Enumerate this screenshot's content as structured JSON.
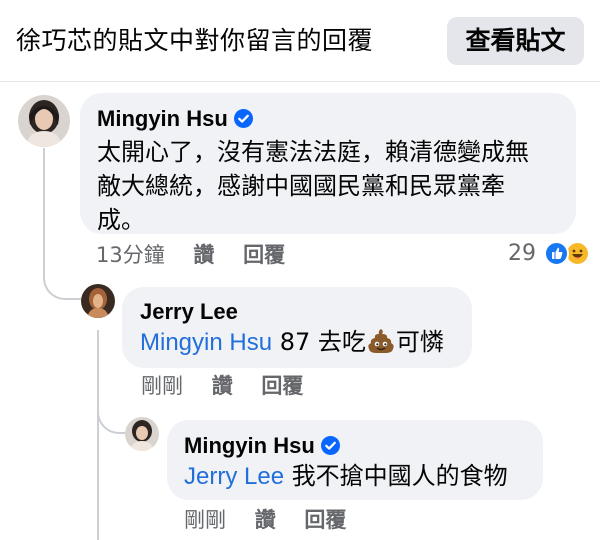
{
  "header": {
    "title": "徐巧芯的貼文中對你留言的回覆",
    "view_post_label": "查看貼文"
  },
  "comments": [
    {
      "author": "Mingyin Hsu",
      "verified": true,
      "text": "太開心了，沒有憲法法庭，賴清德變成無敵大總統，感謝中國國民黨和民眾黨牽成。",
      "text_lines": [
        "太開心了，沒有憲法法庭，賴清德變成無",
        "敵大總統，感謝中國國民黨和民眾黨牽",
        "成。"
      ],
      "time": "13分鐘",
      "like_label": "讚",
      "reply_label": "回覆",
      "reaction_count": "29",
      "reaction_icons": [
        "like-icon",
        "haha-icon"
      ]
    },
    {
      "author": "Jerry Lee",
      "verified": false,
      "mention": "Mingyin Hsu",
      "text_before_icon": "87 去吃",
      "icon": "poop-emoji-icon",
      "text_after_icon": "可憐",
      "time": "剛剛",
      "like_label": "讚",
      "reply_label": "回覆"
    },
    {
      "author": "Mingyin Hsu",
      "verified": true,
      "mention": "Jerry Lee",
      "text": "我不搶中國人的食物",
      "time": "剛剛",
      "like_label": "讚",
      "reply_label": "回覆"
    }
  ],
  "colors": {
    "bubble": "#f0f2f5",
    "mention": "#216fdb",
    "meta": "#65676b",
    "verified": "#0866ff"
  }
}
